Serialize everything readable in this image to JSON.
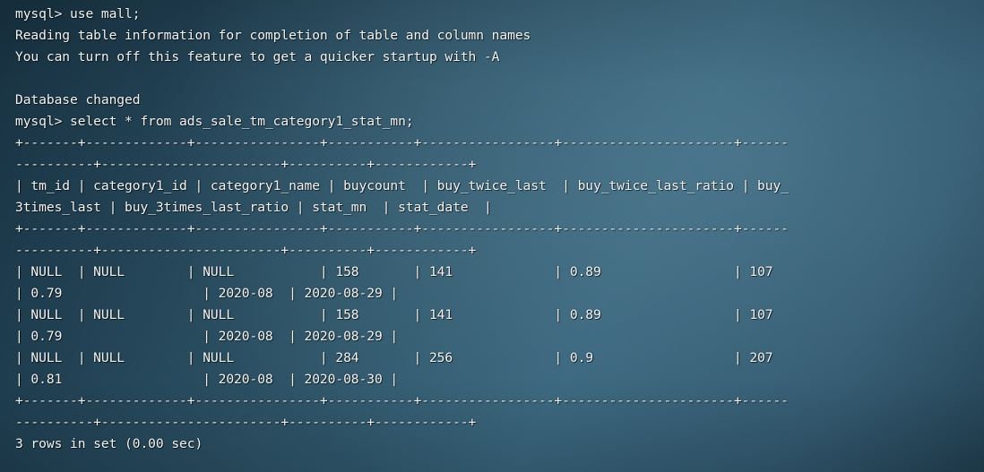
{
  "terminal": {
    "prompt": "mysql>",
    "session_lines": [
      "mysql> use mall;",
      "Reading table information for completion of table and column names",
      "You can turn off this feature to get a quicker startup with -A",
      "",
      "Database changed",
      "mysql> select * from ads_sale_tm_category1_stat_mn;"
    ],
    "commands": [
      "use mall;",
      "select * from ads_sale_tm_category1_stat_mn;"
    ],
    "messages": [
      "Reading table information for completion of table and column names",
      "You can turn off this feature to get a quicker startup with -A",
      "Database changed"
    ],
    "database": "mall",
    "table": "ads_sale_tm_category1_stat_mn",
    "result_footer": "3 rows in set (0.00 sec)",
    "row_count": 3,
    "elapsed": "0.00 sec",
    "separator": "+-------+-------------+----------------+-----------+-----------------+----------------------+----------------+-----------------------+----------+------------+",
    "columns": [
      {
        "name": "tm_id",
        "width": 5
      },
      {
        "name": "category1_id",
        "width": 11
      },
      {
        "name": "category1_name",
        "width": 14
      },
      {
        "name": "buycount",
        "width": 9
      },
      {
        "name": "buy_twice_last",
        "width": 15
      },
      {
        "name": "buy_twice_last_ratio",
        "width": 20
      },
      {
        "name": "buy_3times_last",
        "width": 14
      },
      {
        "name": "buy_3times_last_ratio",
        "width": 21
      },
      {
        "name": "stat_mn",
        "width": 8
      },
      {
        "name": "stat_date",
        "width": 10
      }
    ],
    "rows": [
      {
        "tm_id": "NULL",
        "category1_id": "NULL",
        "category1_name": "NULL",
        "buycount": "158",
        "buy_twice_last": "141",
        "buy_twice_last_ratio": "0.89",
        "buy_3times_last": "107",
        "buy_3times_last_ratio": "0.79",
        "stat_mn": "2020-08",
        "stat_date": "2020-08-29"
      },
      {
        "tm_id": "NULL",
        "category1_id": "NULL",
        "category1_name": "NULL",
        "buycount": "158",
        "buy_twice_last": "141",
        "buy_twice_last_ratio": "0.89",
        "buy_3times_last": "107",
        "buy_3times_last_ratio": "0.79",
        "stat_mn": "2020-08",
        "stat_date": "2020-08-29"
      },
      {
        "tm_id": "NULL",
        "category1_id": "NULL",
        "category1_name": "NULL",
        "buycount": "284",
        "buy_twice_last": "256",
        "buy_twice_last_ratio": "0.9",
        "buy_3times_last": "207",
        "buy_3times_last_ratio": "0.81",
        "stat_mn": "2020-08",
        "stat_date": "2020-08-30"
      }
    ]
  },
  "colors": {
    "text": "#f2f3f3",
    "wallpaper_dark": "#16303f",
    "wallpaper_light": "#336078"
  }
}
